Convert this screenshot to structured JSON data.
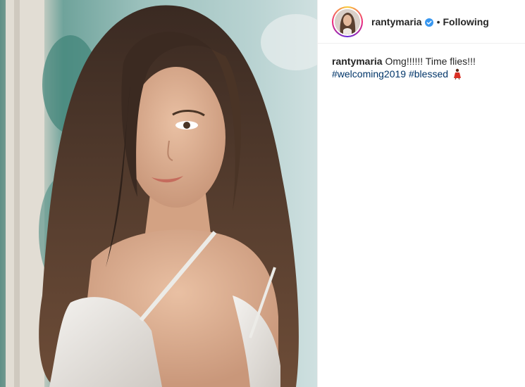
{
  "post": {
    "username": "rantymaria",
    "follow_status": "Following",
    "separator": "•",
    "verified_icon": "verified-badge-icon",
    "accent_color": "#3897f0"
  },
  "caption": {
    "username": "rantymaria",
    "text": "Omg!!!!!! Time flies!!!",
    "hashtags": [
      "#welcoming2019",
      "#blessed"
    ],
    "emoji": "dancer-emoji-icon"
  },
  "colors": {
    "text": "#262626",
    "hashtag": "#003569",
    "border": "#efefef"
  }
}
